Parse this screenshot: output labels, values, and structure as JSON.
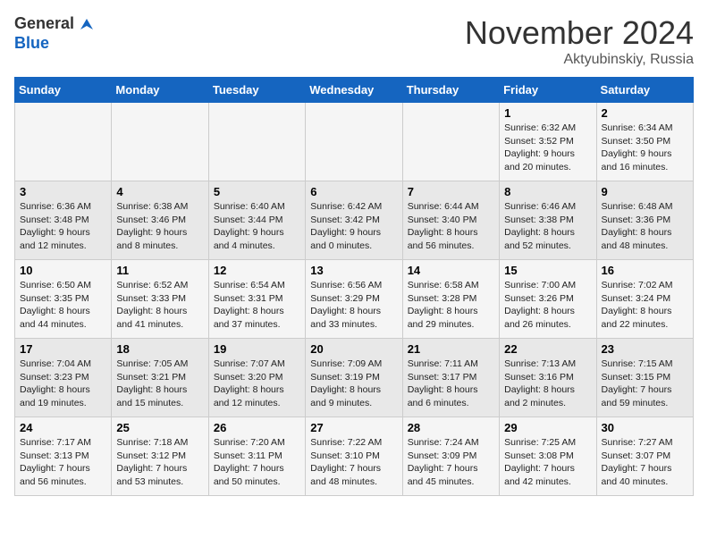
{
  "logo": {
    "line1": "General",
    "line2": "Blue"
  },
  "title": "November 2024",
  "location": "Aktyubinskiy, Russia",
  "weekdays": [
    "Sunday",
    "Monday",
    "Tuesday",
    "Wednesday",
    "Thursday",
    "Friday",
    "Saturday"
  ],
  "weeks": [
    [
      {
        "day": "",
        "info": ""
      },
      {
        "day": "",
        "info": ""
      },
      {
        "day": "",
        "info": ""
      },
      {
        "day": "",
        "info": ""
      },
      {
        "day": "",
        "info": ""
      },
      {
        "day": "1",
        "info": "Sunrise: 6:32 AM\nSunset: 3:52 PM\nDaylight: 9 hours\nand 20 minutes."
      },
      {
        "day": "2",
        "info": "Sunrise: 6:34 AM\nSunset: 3:50 PM\nDaylight: 9 hours\nand 16 minutes."
      }
    ],
    [
      {
        "day": "3",
        "info": "Sunrise: 6:36 AM\nSunset: 3:48 PM\nDaylight: 9 hours\nand 12 minutes."
      },
      {
        "day": "4",
        "info": "Sunrise: 6:38 AM\nSunset: 3:46 PM\nDaylight: 9 hours\nand 8 minutes."
      },
      {
        "day": "5",
        "info": "Sunrise: 6:40 AM\nSunset: 3:44 PM\nDaylight: 9 hours\nand 4 minutes."
      },
      {
        "day": "6",
        "info": "Sunrise: 6:42 AM\nSunset: 3:42 PM\nDaylight: 9 hours\nand 0 minutes."
      },
      {
        "day": "7",
        "info": "Sunrise: 6:44 AM\nSunset: 3:40 PM\nDaylight: 8 hours\nand 56 minutes."
      },
      {
        "day": "8",
        "info": "Sunrise: 6:46 AM\nSunset: 3:38 PM\nDaylight: 8 hours\nand 52 minutes."
      },
      {
        "day": "9",
        "info": "Sunrise: 6:48 AM\nSunset: 3:36 PM\nDaylight: 8 hours\nand 48 minutes."
      }
    ],
    [
      {
        "day": "10",
        "info": "Sunrise: 6:50 AM\nSunset: 3:35 PM\nDaylight: 8 hours\nand 44 minutes."
      },
      {
        "day": "11",
        "info": "Sunrise: 6:52 AM\nSunset: 3:33 PM\nDaylight: 8 hours\nand 41 minutes."
      },
      {
        "day": "12",
        "info": "Sunrise: 6:54 AM\nSunset: 3:31 PM\nDaylight: 8 hours\nand 37 minutes."
      },
      {
        "day": "13",
        "info": "Sunrise: 6:56 AM\nSunset: 3:29 PM\nDaylight: 8 hours\nand 33 minutes."
      },
      {
        "day": "14",
        "info": "Sunrise: 6:58 AM\nSunset: 3:28 PM\nDaylight: 8 hours\nand 29 minutes."
      },
      {
        "day": "15",
        "info": "Sunrise: 7:00 AM\nSunset: 3:26 PM\nDaylight: 8 hours\nand 26 minutes."
      },
      {
        "day": "16",
        "info": "Sunrise: 7:02 AM\nSunset: 3:24 PM\nDaylight: 8 hours\nand 22 minutes."
      }
    ],
    [
      {
        "day": "17",
        "info": "Sunrise: 7:04 AM\nSunset: 3:23 PM\nDaylight: 8 hours\nand 19 minutes."
      },
      {
        "day": "18",
        "info": "Sunrise: 7:05 AM\nSunset: 3:21 PM\nDaylight: 8 hours\nand 15 minutes."
      },
      {
        "day": "19",
        "info": "Sunrise: 7:07 AM\nSunset: 3:20 PM\nDaylight: 8 hours\nand 12 minutes."
      },
      {
        "day": "20",
        "info": "Sunrise: 7:09 AM\nSunset: 3:19 PM\nDaylight: 8 hours\nand 9 minutes."
      },
      {
        "day": "21",
        "info": "Sunrise: 7:11 AM\nSunset: 3:17 PM\nDaylight: 8 hours\nand 6 minutes."
      },
      {
        "day": "22",
        "info": "Sunrise: 7:13 AM\nSunset: 3:16 PM\nDaylight: 8 hours\nand 2 minutes."
      },
      {
        "day": "23",
        "info": "Sunrise: 7:15 AM\nSunset: 3:15 PM\nDaylight: 7 hours\nand 59 minutes."
      }
    ],
    [
      {
        "day": "24",
        "info": "Sunrise: 7:17 AM\nSunset: 3:13 PM\nDaylight: 7 hours\nand 56 minutes."
      },
      {
        "day": "25",
        "info": "Sunrise: 7:18 AM\nSunset: 3:12 PM\nDaylight: 7 hours\nand 53 minutes."
      },
      {
        "day": "26",
        "info": "Sunrise: 7:20 AM\nSunset: 3:11 PM\nDaylight: 7 hours\nand 50 minutes."
      },
      {
        "day": "27",
        "info": "Sunrise: 7:22 AM\nSunset: 3:10 PM\nDaylight: 7 hours\nand 48 minutes."
      },
      {
        "day": "28",
        "info": "Sunrise: 7:24 AM\nSunset: 3:09 PM\nDaylight: 7 hours\nand 45 minutes."
      },
      {
        "day": "29",
        "info": "Sunrise: 7:25 AM\nSunset: 3:08 PM\nDaylight: 7 hours\nand 42 minutes."
      },
      {
        "day": "30",
        "info": "Sunrise: 7:27 AM\nSunset: 3:07 PM\nDaylight: 7 hours\nand 40 minutes."
      }
    ]
  ]
}
